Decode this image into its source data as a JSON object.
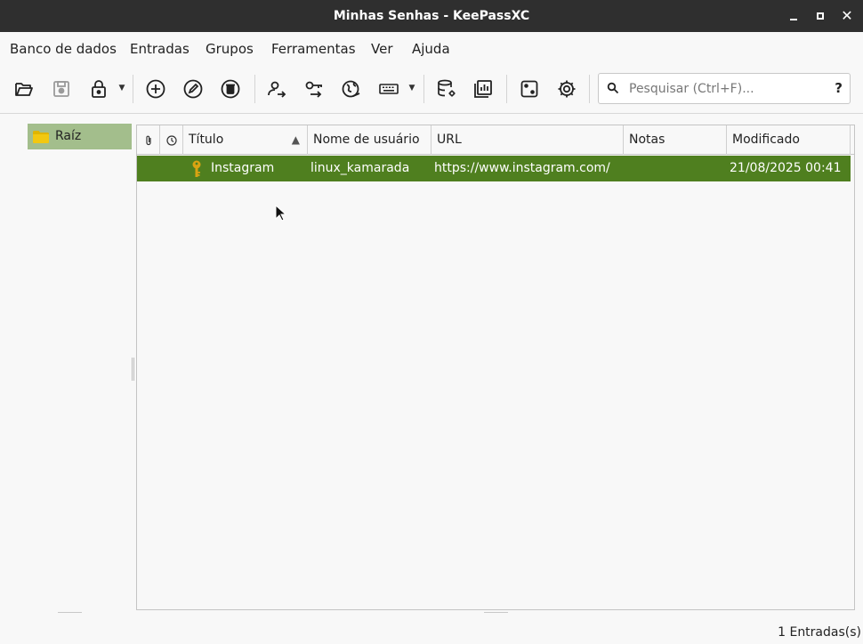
{
  "window": {
    "title": "Minhas Senhas - KeePassXC"
  },
  "menubar": {
    "items": [
      "Banco de dados",
      "Entradas",
      "Grupos",
      "Ferramentas",
      "Ver",
      "Ajuda"
    ]
  },
  "toolbar": {
    "icons": [
      "folder-open-icon",
      "save-icon",
      "lock-icon",
      "add-entry-icon",
      "edit-entry-icon",
      "delete-entry-icon",
      "copy-username-icon",
      "copy-password-icon",
      "open-url-icon",
      "autotype-keyboard-icon",
      "database-settings-icon",
      "reports-icon",
      "password-generator-icon",
      "settings-gear-icon"
    ]
  },
  "search": {
    "placeholder": "Pesquisar (Ctrl+F)...",
    "value": "",
    "help_label": "?"
  },
  "groups": {
    "items": [
      {
        "label": "Raíz"
      }
    ]
  },
  "entries": {
    "columns": [
      "Título",
      "Nome de usuário",
      "URL",
      "Notas",
      "Modificado"
    ],
    "sort_indicator": "▲",
    "rows": [
      {
        "title": "Instagram",
        "username": "linux_kamarada",
        "url": "https://www.instagram.com/",
        "notes": "",
        "modified": "21/08/2025 00:41"
      }
    ]
  },
  "status": {
    "text": "1 Entradas(s)"
  },
  "colors": {
    "titlebar": "#2f2f2f",
    "selected_group": "#a3be8c",
    "selected_row": "#4f7f1f",
    "key_icon": "#d9a312",
    "folder_icon": "#e0b500"
  }
}
